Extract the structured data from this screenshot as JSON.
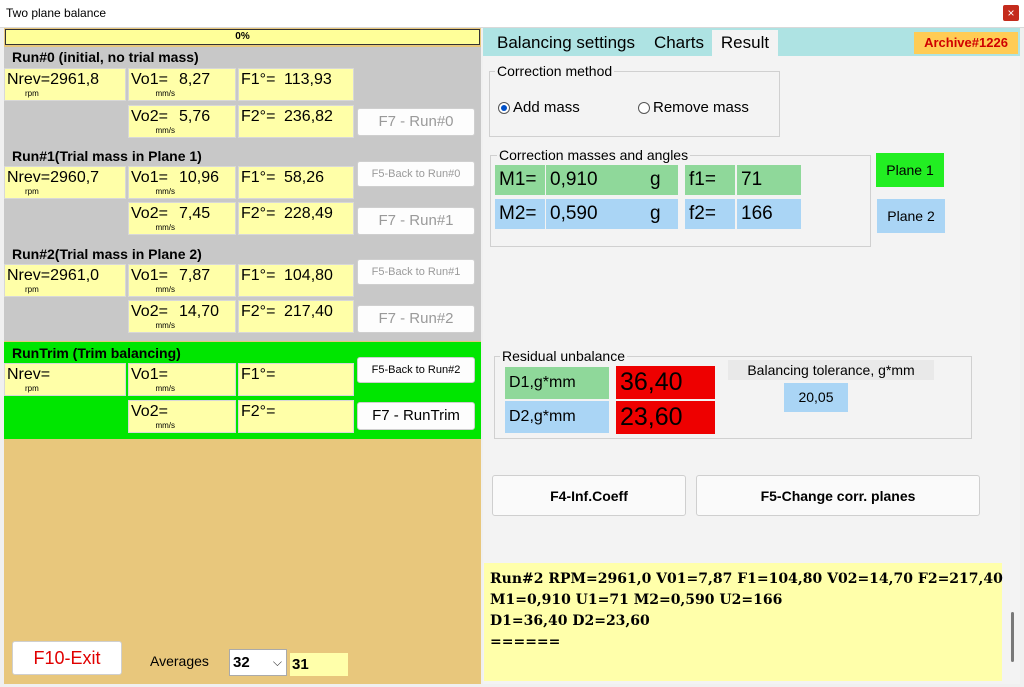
{
  "window": {
    "title": "Two plane balance",
    "close_glyph": "×"
  },
  "progress": {
    "label": "0%",
    "value": 0
  },
  "runs": [
    {
      "title": "Run#0 (initial, no trial mass)",
      "nrev": "Nrev=2961,8",
      "nrev_unit": "rpm",
      "vo1": "Vo1=",
      "vo1_val": "8,27",
      "vo1_unit": "mm/s",
      "f1": "F1°=",
      "f1_val": "113,93",
      "vo2": "Vo2=",
      "vo2_val": "5,76",
      "vo2_unit": "mm/s",
      "f2": "F2°=",
      "f2_val": "236,82",
      "btn_run": "F7 - Run#0"
    },
    {
      "title": "Run#1(Trial mass in Plane 1)",
      "nrev": "Nrev=2960,7",
      "nrev_unit": "rpm",
      "vo1": "Vo1=",
      "vo1_val": "10,96",
      "vo1_unit": "mm/s",
      "f1": "F1°=",
      "f1_val": "58,26",
      "vo2": "Vo2=",
      "vo2_val": "7,45",
      "vo2_unit": "mm/s",
      "f2": "F2°=",
      "f2_val": "228,49",
      "btn_back": "F5-Back to Run#0",
      "btn_run": "F7 - Run#1"
    },
    {
      "title": "Run#2(Trial mass in Plane 2)",
      "nrev": "Nrev=2961,0",
      "nrev_unit": "rpm",
      "vo1": "Vo1=",
      "vo1_val": "7,87",
      "vo1_unit": "mm/s",
      "f1": "F1°=",
      "f1_val": "104,80",
      "vo2": "Vo2=",
      "vo2_val": "14,70",
      "vo2_unit": "mm/s",
      "f2": "F2°=",
      "f2_val": "217,40",
      "btn_back": "F5-Back to Run#1",
      "btn_run": "F7 - Run#2"
    },
    {
      "title": "RunTrim (Trim balancing)",
      "nrev": "Nrev=",
      "nrev_unit": "rpm",
      "vo1": "Vo1=",
      "vo1_val": "",
      "vo1_unit": "mm/s",
      "f1": "F1°=",
      "f1_val": "",
      "vo2": "Vo2=",
      "vo2_val": "",
      "vo2_unit": "mm/s",
      "f2": "F2°=",
      "f2_val": "",
      "btn_back": "F5-Back to Run#2",
      "btn_run": "F7 - RunTrim"
    }
  ],
  "tabs": [
    {
      "label": "Balancing settings"
    },
    {
      "label": "Charts"
    },
    {
      "label": "Result"
    }
  ],
  "archive": "Archive#1226",
  "correction_method": {
    "label": "Correction method",
    "add": "Add mass",
    "remove": "Remove mass",
    "selected": "Add mass"
  },
  "correction": {
    "label": "Correction masses and angles",
    "m1_label": "M1=",
    "m1_val": "0,910",
    "m1_unit": "g",
    "f1_label": "f1=",
    "f1_val": "71",
    "m2_label": "M2=",
    "m2_val": "0,590",
    "m2_unit": "g",
    "f2_label": "f2=",
    "f2_val": "166",
    "plane1": "Plane 1",
    "plane2": "Plane 2"
  },
  "residual": {
    "label": "Residual unbalance",
    "d1_label": "D1,g*mm",
    "d1_val": "36,40",
    "d2_label": "D2,g*mm",
    "d2_val": "23,60",
    "tol_label": "Balancing tolerance, g*mm",
    "tol_val": "20,05"
  },
  "buttons": {
    "inf_coeff": "F4-Inf.Coeff",
    "change_planes": "F5-Change corr. planes",
    "exit": "F10-Exit"
  },
  "log": [
    "Run#2 RPM=2961,0 V01=7,87 F1=104,80 V02=14,70 F2=217,40",
    "M1=0,910 U1=71 M2=0,590 U2=166",
    "D1=36,40 D2=23,60",
    "======"
  ],
  "averages": {
    "label": "Averages",
    "selected": "32",
    "value": "31"
  },
  "colors": {
    "trial_bg": "#c8c8c8",
    "trim_bg": "#00e600",
    "panel_bg": "#e8c77c",
    "cell_bg": "#ffffa8",
    "plane1_bg": "#22ee22",
    "plane2_bg": "#aad5f5",
    "exit_text": "#e00000",
    "archive_text": "#d00000"
  }
}
